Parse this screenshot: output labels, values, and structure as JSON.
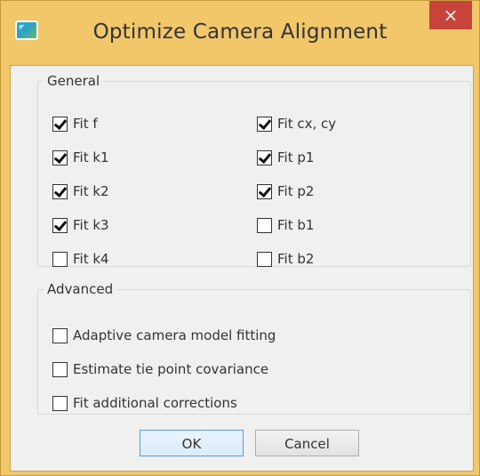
{
  "window": {
    "title": "Optimize Camera Alignment",
    "close_label": "×"
  },
  "general": {
    "legend": "General",
    "left": [
      {
        "label": "Fit f",
        "checked": true
      },
      {
        "label": "Fit k1",
        "checked": true
      },
      {
        "label": "Fit k2",
        "checked": true
      },
      {
        "label": "Fit k3",
        "checked": true
      },
      {
        "label": "Fit k4",
        "checked": false
      }
    ],
    "right": [
      {
        "label": "Fit cx, cy",
        "checked": true
      },
      {
        "label": "Fit p1",
        "checked": true
      },
      {
        "label": "Fit p2",
        "checked": true
      },
      {
        "label": "Fit b1",
        "checked": false
      },
      {
        "label": "Fit b2",
        "checked": false
      }
    ]
  },
  "advanced": {
    "legend": "Advanced",
    "options": [
      {
        "label": "Adaptive camera model fitting",
        "checked": false
      },
      {
        "label": "Estimate tie point covariance",
        "checked": false
      },
      {
        "label": "Fit additional corrections",
        "checked": false
      }
    ]
  },
  "buttons": {
    "ok": "OK",
    "cancel": "Cancel"
  }
}
